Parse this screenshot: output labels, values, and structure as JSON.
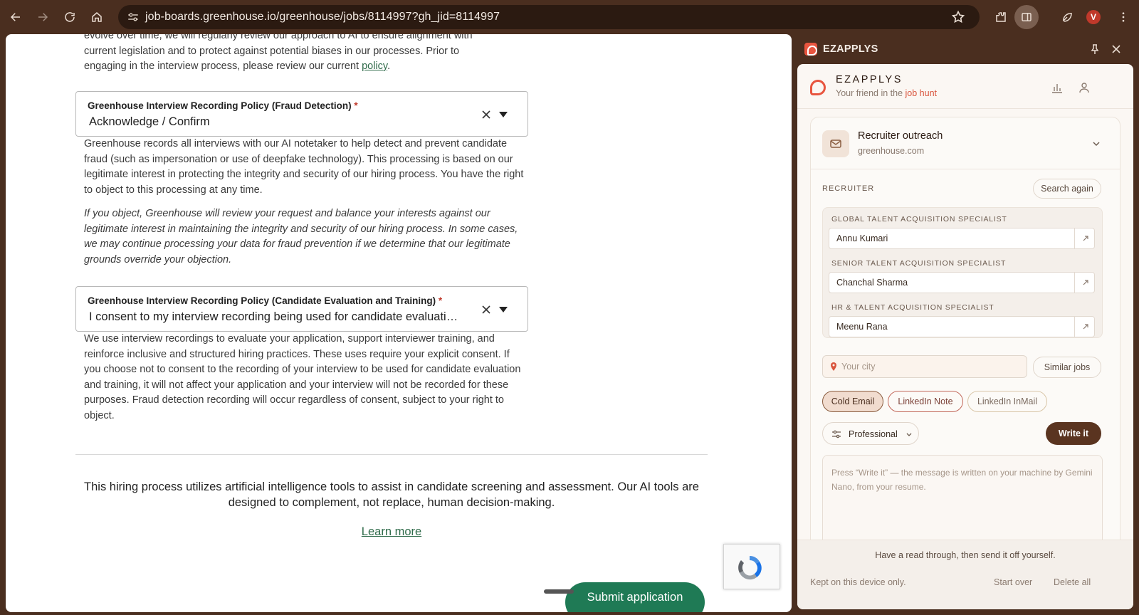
{
  "browser": {
    "url": "job-boards.greenhouse.io/greenhouse/jobs/8114997?gh_jid=8114997",
    "avatar_initial": "V"
  },
  "page": {
    "intro_line_1": "evolve over time, we will regularly review our approach to AI to ensure alignment with",
    "intro_line_2": "current legislation and to protect against potential biases in our processes. Prior to",
    "intro_line_3": "engaging in the interview process, please review our current ",
    "policy_link": "policy",
    "intro_end": ".",
    "fraud_select": {
      "label": "Greenhouse Interview Recording Policy (Fraud Detection)",
      "required_mark": "*",
      "value": "Acknowledge / Confirm"
    },
    "fraud_text": "Greenhouse records all interviews with our AI notetaker to help detect and prevent candidate fraud (such as impersonation or use of deepfake technology). This processing is based on our legitimate interest in protecting the integrity and security of our hiring process. You have the right to object to this processing at any time.",
    "fraud_italic": "If you object, Greenhouse will review your request and balance your interests against our legitimate interest in maintaining the integrity and security of our hiring process. In some cases, we may continue processing your data for fraud prevention if we determine that our legitimate grounds override your objection.",
    "eval_select": {
      "label": "Greenhouse Interview Recording Policy (Candidate Evaluation and Training)",
      "required_mark": "*",
      "value": "I consent to my interview recording being used for candidate evaluation and training"
    },
    "eval_text": "We use interview recordings to evaluate your application, support interviewer training, and reinforce inclusive and structured hiring practices. These uses require your explicit consent. If you choose not to consent to the recording of your interview to be used for candidate evaluation and training, it will not affect your application and your interview will not be recorded for these purposes. Fraud detection recording will occur regardless of consent, subject to your right to object.",
    "ai_notice": "This hiring process utilizes artificial intelligence tools to assist in candidate screening and assessment. Our AI tools are designed to complement, not replace, human decision-making.",
    "learn_more": "Learn more",
    "submit": "Submit application"
  },
  "sidepanel": {
    "header_title": "EZAPPLYS",
    "brand_name": "EZAPPLYS",
    "tagline_prefix": "Your friend in the ",
    "tagline_highlight": "job hunt",
    "outreach": {
      "title": "Recruiter outreach",
      "domain": "greenhouse.com"
    },
    "recruiter_label": "RECRUITER",
    "search_again": "Search again",
    "recruiters": [
      {
        "role": "GLOBAL TALENT ACQUISITION SPECIALIST",
        "name": "Annu Kumari"
      },
      {
        "role": "SENIOR TALENT ACQUISITION SPECIALIST",
        "name": "Chanchal Sharma"
      },
      {
        "role": "HR & TALENT ACQUISITION SPECIALIST",
        "name": "Meenu Rana"
      }
    ],
    "city_placeholder": "Your city",
    "similar_jobs": "Similar jobs",
    "tabs": [
      "Cold Email",
      "LinkedIn Note",
      "LinkedIn InMail"
    ],
    "tone": "Professional",
    "write_it": "Write it",
    "message_placeholder": "Press “Write it” — the message is written on your machine by Gemini Nano, from your resume.",
    "footer_note": "Have a read through, then send it off yourself.",
    "kept_local": "Kept on this device only.",
    "start_over": "Start over",
    "delete_all": "Delete all"
  },
  "colors": {
    "browser_chrome": "#4a2e1f",
    "greenhouse_green": "#1f7a55",
    "brand_accent": "#e8553f",
    "write_button": "#5a3420"
  }
}
